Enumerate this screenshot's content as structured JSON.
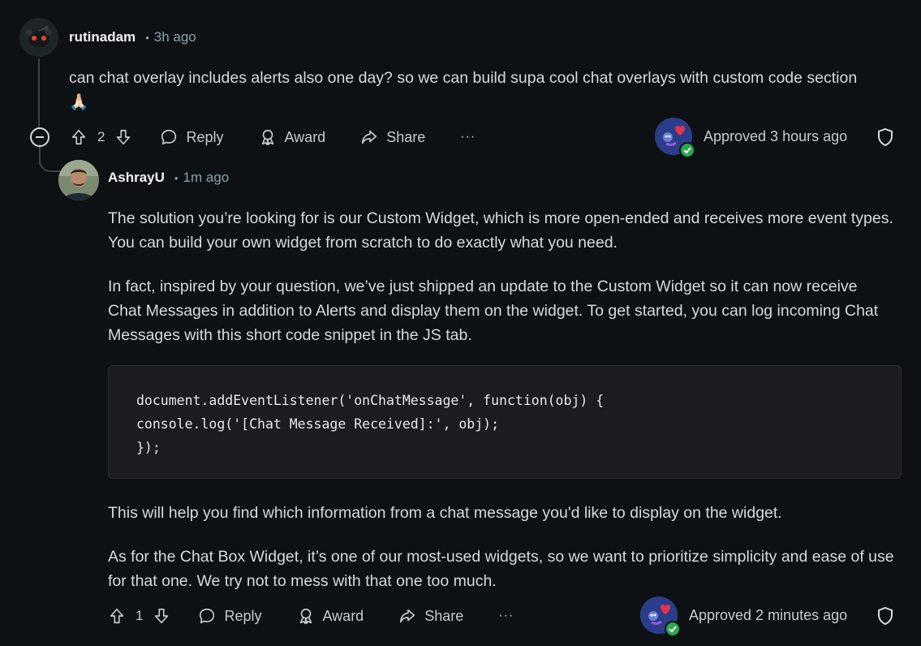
{
  "comment1": {
    "username": "rutinadam",
    "time": "3h ago",
    "body": "can chat overlay includes alerts also one day? so we can build supa cool chat overlays with custom code section 🙏🏻",
    "votes": "2",
    "reply_label": "Reply",
    "award_label": "Award",
    "share_label": "Share",
    "more_label": "···",
    "approved": "Approved 3 hours ago"
  },
  "comment2": {
    "username": "AshrayU",
    "time": "1m ago",
    "paragraphs": [
      "The solution you’re looking for is our Custom Widget, which is more open-ended and receives more event types. You can build your own widget from scratch to do exactly what you need.",
      "In fact, inspired by your question, we’ve just shipped an update to the Custom Widget so it can now receive Chat Messages in addition to Alerts and display them on the widget. To get started, you can log incoming Chat Messages with this short code snippet in the JS tab.",
      "This will help you find which information from a chat message you'd like to display on the widget.",
      "As for the Chat Box Widget, it’s one of our most-used widgets, so we want to prioritize simplicity and ease of use for that one. We try not to mess with that one too much."
    ],
    "code": "document.addEventListener('onChatMessage', function(obj) {\nconsole.log('[Chat Message Received]:', obj);\n});",
    "votes": "1",
    "reply_label": "Reply",
    "award_label": "Award",
    "share_label": "Share",
    "more_label": "···",
    "approved": "Approved 2 minutes ago"
  },
  "icons": {
    "upvote": "upvote-icon",
    "downvote": "downvote-icon",
    "reply": "reply-icon",
    "award": "award-icon",
    "share": "share-icon",
    "more": "more-icon",
    "shield": "shield-icon",
    "collapse": "collapse-icon"
  },
  "colors": {
    "background": "#0e1113",
    "text": "#d7dadc",
    "meta": "#8ba2ad",
    "code_bg": "#1a1c1f",
    "approved_check": "#2aa84a"
  }
}
